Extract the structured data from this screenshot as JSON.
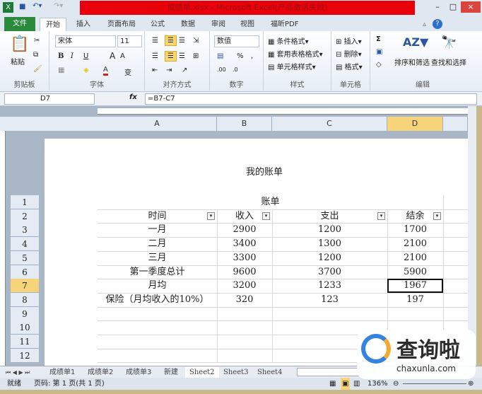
{
  "window": {
    "title": "成绩单.xlsx - Microsoft Excel(产品激活失败)",
    "minimize": "–",
    "maximize": "□",
    "close": "×"
  },
  "ribbon_tabs": [
    "文件",
    "开始",
    "插入",
    "页面布局",
    "公式",
    "数据",
    "审阅",
    "视图",
    "福昕PDF"
  ],
  "ribbon": {
    "clipboard": {
      "paste": "粘贴",
      "label": "剪贴板"
    },
    "font": {
      "name": "宋体",
      "size": "11",
      "bold": "B",
      "italic": "I",
      "underline": "U",
      "grow": "A",
      "shrink": "A",
      "color": "A",
      "wen": "变",
      "label": "字体"
    },
    "alignment": {
      "label": "对齐方式"
    },
    "number": {
      "format": "数值",
      "percent": "%",
      "comma": ",",
      "label": "数字"
    },
    "styles": {
      "conditional": "条件格式",
      "table": "套用表格格式",
      "cell": "单元格样式",
      "label": "样式"
    },
    "cells": {
      "insert": "插入",
      "delete": "删除",
      "format": "格式",
      "label": "单元格"
    },
    "editing": {
      "sum": "Σ",
      "sort": "排序和筛选",
      "find": "查找和选择",
      "label": "编辑"
    }
  },
  "formula_bar": {
    "name_box": "D7",
    "fx": "fx",
    "formula": "=B7-C7"
  },
  "columns": [
    "A",
    "B",
    "C",
    "D"
  ],
  "rows": [
    "1",
    "2",
    "3",
    "4",
    "5",
    "6",
    "7",
    "8",
    "9",
    "10",
    "11",
    "12"
  ],
  "page_header": "我的账单",
  "table": {
    "title": "账单",
    "headers": [
      "时间",
      "收入",
      "支出",
      "结余"
    ],
    "rows": [
      [
        "一月",
        "2900",
        "1200",
        "1700"
      ],
      [
        "二月",
        "3400",
        "1300",
        "2100"
      ],
      [
        "三月",
        "3300",
        "1200",
        "2100"
      ],
      [
        "第一季度总计",
        "9600",
        "3700",
        "5900"
      ],
      [
        "月均",
        "3200",
        "1233",
        "1967"
      ],
      [
        "保险（月均收入的10%）",
        "320",
        "123",
        "197"
      ]
    ]
  },
  "selected_cell": "D7",
  "sheet_tabs": [
    "成绩单1",
    "成绩单2",
    "成绩单3",
    "新建",
    "Sheet2",
    "Sheet3",
    "Sheet4"
  ],
  "active_sheet": "Sheet2",
  "status": {
    "ready": "就绪",
    "page": "页码: 第 1 页(共 1 页)",
    "zoom": "136%"
  },
  "watermark": {
    "text": "查询啦",
    "url": "chaxunla.com"
  }
}
